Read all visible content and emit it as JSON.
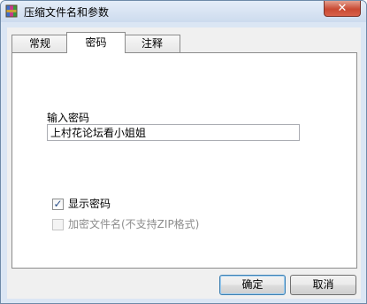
{
  "window": {
    "title": "压缩文件名和参数",
    "close_symbol": "✕",
    "app_icon": "winrar-archive-icon"
  },
  "tabs": [
    {
      "label": "常规",
      "selected": false
    },
    {
      "label": "密码",
      "selected": true
    },
    {
      "label": "注释",
      "selected": false
    }
  ],
  "password": {
    "label": "输入密码",
    "value": "上村花论坛看小姐姐"
  },
  "options": {
    "show_password": {
      "label": "显示密码",
      "checked": true,
      "enabled": true
    },
    "encrypt_filenames": {
      "label": "加密文件名(不支持ZIP格式)",
      "checked": false,
      "enabled": false
    }
  },
  "buttons": {
    "ok": "确定",
    "cancel": "取消"
  },
  "colors": {
    "titlebar": "#cddbee",
    "close_button": "#c94a33",
    "panel": "#ffffff",
    "dialog": "#f0f0f0"
  }
}
